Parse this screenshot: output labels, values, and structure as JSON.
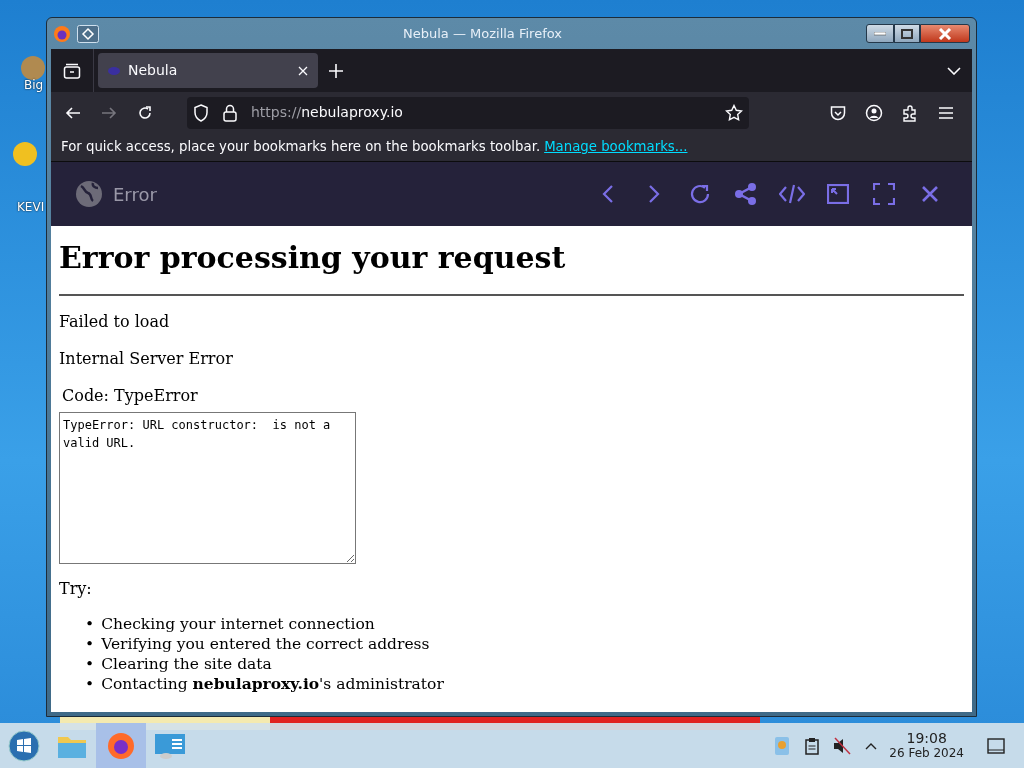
{
  "desktop": {
    "icons": [
      {
        "label": "Big"
      },
      {
        "label": "KEVI"
      }
    ]
  },
  "window": {
    "title": "Nebula — Mozilla Firefox"
  },
  "tabs": [
    {
      "label": "Nebula",
      "selected": true
    }
  ],
  "address_bar": {
    "scheme": "https://",
    "host": "nebulaproxy.io"
  },
  "bookmarks_bar": {
    "message": "For quick access, place your bookmarks here on the bookmarks toolbar.",
    "link": "Manage bookmarks..."
  },
  "proxy_toolbar": {
    "title": "Error"
  },
  "page": {
    "heading": "Error processing your request",
    "lines": [
      "Failed to load",
      "Internal Server Error"
    ],
    "code_label": "Code: TypeError",
    "error_text": "TypeError: URL constructor:  is not a valid URL.",
    "try_label": "Try:",
    "marker": "•",
    "suggestions": [
      "Checking your internet connection",
      "Verifying you entered the correct address",
      "Clearing the site data",
      "Contacting **nebulaproxy.io**'s administrator"
    ]
  },
  "taskbar": {
    "time": "19:08",
    "date": "26 Feb 2024"
  }
}
